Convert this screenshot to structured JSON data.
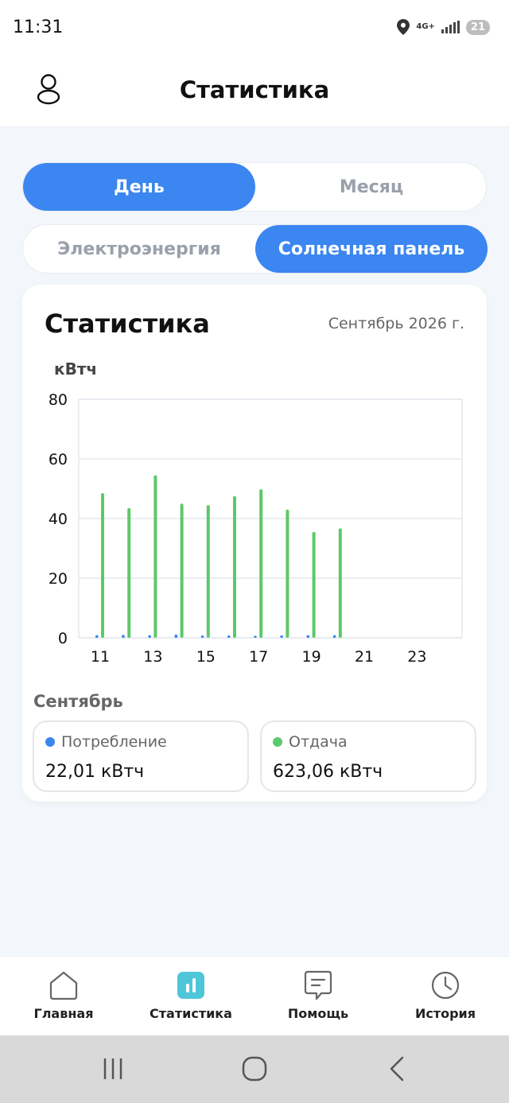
{
  "status_bar": {
    "time": "11:31",
    "network": "4G+",
    "battery": "21"
  },
  "header": {
    "title": "Статистика",
    "profile_icon": "user-icon"
  },
  "period_tabs": [
    {
      "label": "День",
      "active": true
    },
    {
      "label": "Месяц",
      "active": false
    }
  ],
  "source_tabs": [
    {
      "label": "Электроэнергия",
      "active": false
    },
    {
      "label": "Солнечная панель",
      "active": true
    }
  ],
  "card": {
    "title": "Статистика",
    "date": "Сентябрь 2026 г.",
    "month_label": "Сентябрь"
  },
  "chart_data": {
    "type": "bar",
    "ylabel": "кВтч",
    "ylim": [
      0,
      80
    ],
    "yticks": [
      "80",
      "60",
      "40",
      "20",
      "0"
    ],
    "x_tick_labels": [
      "11",
      "13",
      "15",
      "17",
      "19",
      "21",
      "23"
    ],
    "categories": [
      11,
      12,
      13,
      14,
      15,
      16,
      17,
      18,
      19,
      20,
      21,
      22,
      23,
      24
    ],
    "series": [
      {
        "name": "Потребление",
        "color": "#3b86f0",
        "values": [
          0.6,
          0.7,
          0.6,
          0.8,
          0.5,
          0.5,
          0.4,
          0.5,
          0.6,
          0.6,
          null,
          null,
          null,
          null
        ]
      },
      {
        "name": "Отдача",
        "color": "#5cc96a",
        "values": [
          48.5,
          43.5,
          54.5,
          45,
          44.5,
          47.5,
          49.8,
          43,
          35.5,
          36.7,
          null,
          null,
          null,
          null
        ]
      }
    ],
    "grid": true,
    "legend": "none"
  },
  "stats": [
    {
      "label": "Потребление",
      "value": "22,01  кВтч",
      "color": "#3b86f0"
    },
    {
      "label": "Отдача",
      "value": "623,06  кВтч",
      "color": "#5cc96a"
    }
  ],
  "bottom_nav": [
    {
      "label": "Главная",
      "icon": "home-icon",
      "active": false
    },
    {
      "label": "Статистика",
      "icon": "stats-icon",
      "active": true
    },
    {
      "label": "Помощь",
      "icon": "help-chat-icon",
      "active": false
    },
    {
      "label": "История",
      "icon": "history-clock-icon",
      "active": false
    }
  ],
  "system_nav": [
    "recent-apps-icon",
    "home-circle-icon",
    "back-icon"
  ]
}
